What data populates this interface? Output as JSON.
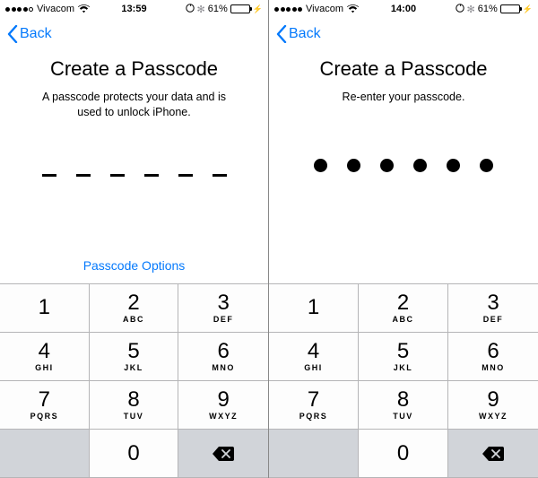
{
  "screens": [
    {
      "status": {
        "carrier": "Vivacom",
        "time": "13:59",
        "battery_pct": "61%"
      },
      "nav": {
        "back_label": "Back"
      },
      "title": "Create a Passcode",
      "subtitle": "A passcode protects your data and is\nused to unlock iPhone.",
      "passcode_style": "dash",
      "options_label": "Passcode Options"
    },
    {
      "status": {
        "carrier": "Vivacom",
        "time": "14:00",
        "battery_pct": "61%"
      },
      "nav": {
        "back_label": "Back"
      },
      "title": "Create a Passcode",
      "subtitle": "Re-enter your passcode.",
      "passcode_style": "dot",
      "options_label": ""
    }
  ],
  "keypad": [
    {
      "n": "1",
      "l": ""
    },
    {
      "n": "2",
      "l": "ABC"
    },
    {
      "n": "3",
      "l": "DEF"
    },
    {
      "n": "4",
      "l": "GHI"
    },
    {
      "n": "5",
      "l": "JKL"
    },
    {
      "n": "6",
      "l": "MNO"
    },
    {
      "n": "7",
      "l": "PQRS"
    },
    {
      "n": "8",
      "l": "TUV"
    },
    {
      "n": "9",
      "l": "WXYZ"
    }
  ],
  "zero_key": "0"
}
